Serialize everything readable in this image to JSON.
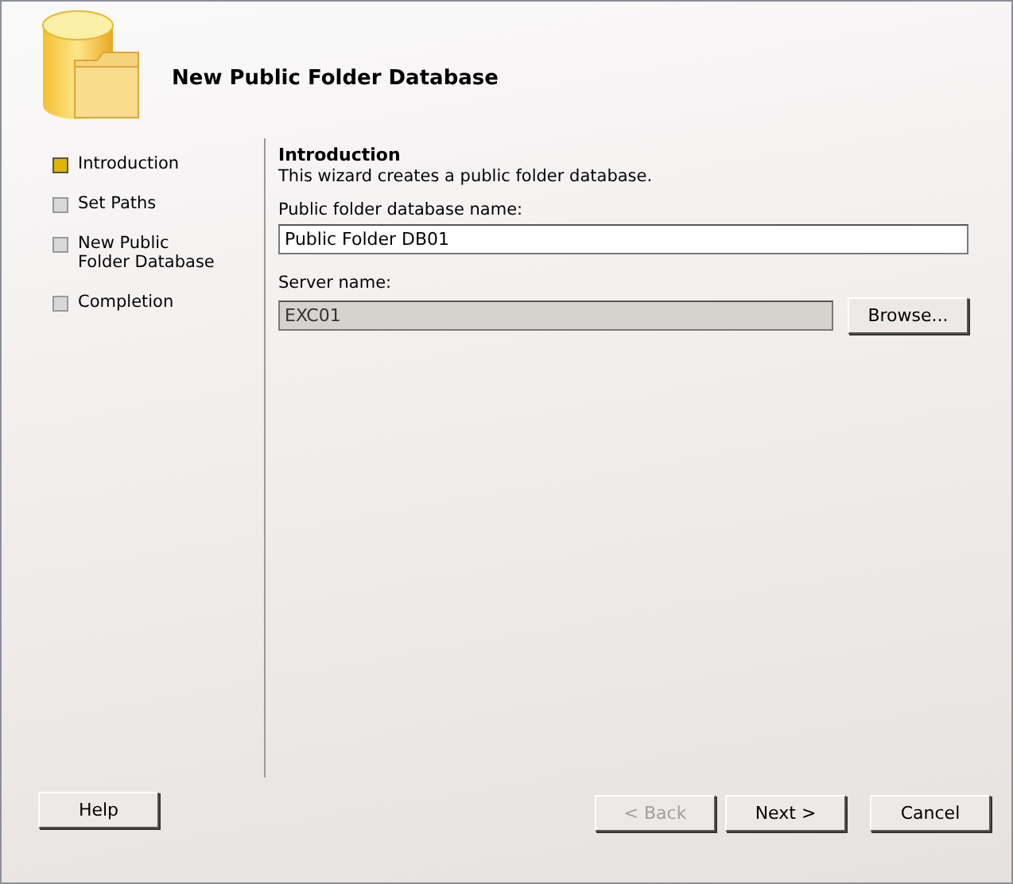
{
  "header": {
    "title": "New Public Folder Database"
  },
  "steps": [
    {
      "label": "Introduction",
      "selected": true
    },
    {
      "label": "Set Paths",
      "selected": false
    },
    {
      "label": "New Public Folder Database",
      "selected": false
    },
    {
      "label": "Completion",
      "selected": false
    }
  ],
  "page": {
    "heading": "Introduction",
    "description": "This wizard creates a public folder database.",
    "fields": [
      {
        "label": "Public folder database name:",
        "value": "Public Folder DB01",
        "disabled": false
      },
      {
        "label": "Server name:",
        "value": "EXC01",
        "disabled": true,
        "button": "Browse..."
      }
    ]
  },
  "buttons": [
    {
      "label": "Help",
      "disabled": false,
      "kind": "left"
    },
    {
      "label": "< Back",
      "disabled": true,
      "kind": "right"
    },
    {
      "label": "Next >",
      "disabled": false,
      "kind": "right"
    },
    {
      "label": "Cancel",
      "disabled": false,
      "kind": "right"
    }
  ]
}
